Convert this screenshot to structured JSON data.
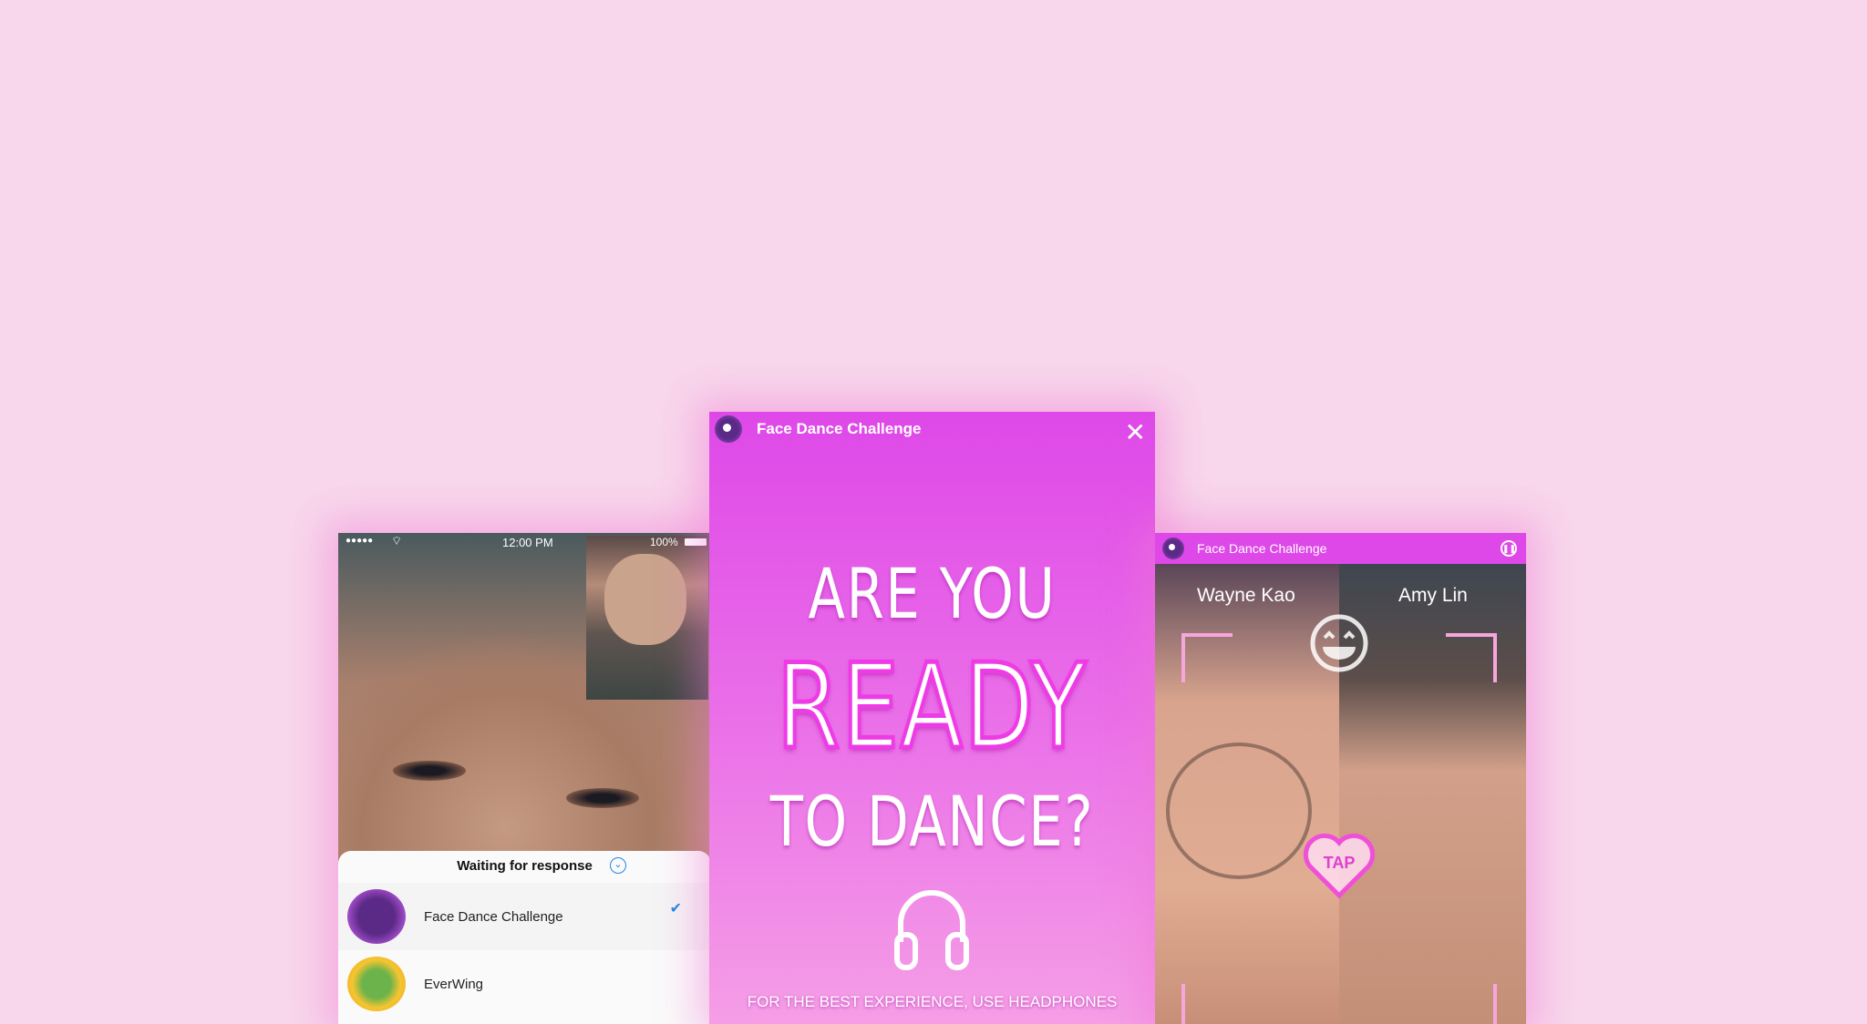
{
  "left_phone": {
    "status": {
      "signal": "●●●●●",
      "time": "12:00 PM",
      "battery": "100%"
    },
    "sheet": {
      "title": "Waiting for response",
      "items": [
        {
          "label": "Face Dance Challenge",
          "selected": true
        },
        {
          "label": "EverWing",
          "selected": false
        }
      ]
    }
  },
  "mid_phone": {
    "title": "Face Dance Challenge",
    "line1": "ARE YOU",
    "line2": "READY",
    "line3": "TO DANCE?",
    "footer": "FOR THE BEST EXPERIENCE, USE HEADPHONES"
  },
  "right_phone": {
    "title": "Face Dance Challenge",
    "player1": "Wayne Kao",
    "player2": "Amy Lin",
    "tap": "TAP"
  },
  "colors": {
    "background": "#f8d7ec",
    "accent": "#de48e8",
    "check": "#1e88e5"
  }
}
